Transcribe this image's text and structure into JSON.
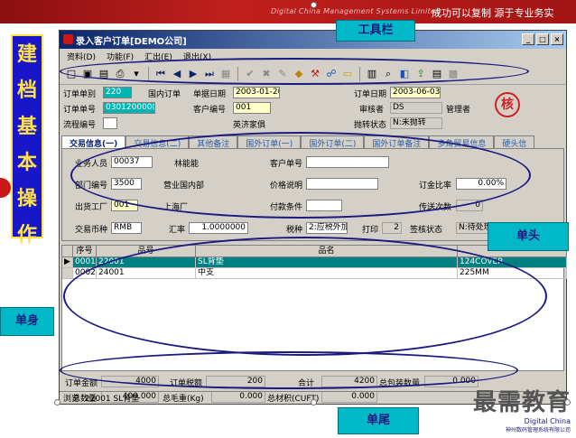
{
  "banner": {
    "english": "Digital China Management Systems Limited",
    "slogan": "成功可以复制   源于专业务实"
  },
  "side_title": {
    "chars": [
      "建",
      "档",
      "基",
      "本",
      "操",
      "作"
    ]
  },
  "window": {
    "title": "录入客户订单[DEMO公司]",
    "controls": [
      "_",
      "□",
      "×"
    ],
    "menu": [
      "资料(D)",
      "功能(F)",
      "汇出(E)",
      "退出(X)"
    ]
  },
  "toolbar_icons": [
    "new-icon",
    "save-icon",
    "delete-icon",
    "print-icon",
    "dropdown-icon",
    "first-icon",
    "prev-icon",
    "next-icon",
    "last-icon",
    "copy-icon",
    "check-icon",
    "cancel-icon",
    "edit-icon",
    "approve-icon",
    "tool-icon",
    "link-icon",
    "folder-icon",
    "attach-icon",
    "find-icon",
    "chart-icon",
    "export-icon",
    "report-icon",
    "calc-icon"
  ],
  "header": {
    "order_type_label": "订单单别",
    "order_type": "220",
    "order_type_name": "国内订单",
    "quote_date_label": "单据日期",
    "quote_date": "2003-01-20",
    "order_date_label": "订单日期",
    "order_date": "2003-06-03",
    "order_no_label": "订单单号",
    "order_no": "03012000001",
    "customer_no_label": "客户编号",
    "customer_no": "001",
    "customer_name": "英济家俱",
    "reviewer_label": "审核者",
    "reviewer": "DS",
    "reviewer_role": "管理者",
    "process_no_label": "流程编号",
    "transfer_status_label": "抛转状态",
    "transfer_status": "N:未抛转",
    "stamp": "核"
  },
  "tabs": [
    "交易信息(一)",
    "交易信息(二)",
    "其他备注",
    "国外订单(一)",
    "国外订单(二)",
    "国外订单备注",
    "多角贸易信息",
    "硬头信"
  ],
  "panel": {
    "salesperson_label": "业务人员",
    "salesperson": "00037",
    "salesperson_name": "林能能",
    "cust_order_label": "客户单号",
    "cust_order": "",
    "dept_label": "部门编号",
    "dept": "3500",
    "dept_name": "营业国内部",
    "price_label": "价格说明",
    "price": "",
    "deposit_label": "订金比率",
    "deposit": "0.00%",
    "factory_label": "出货工厂",
    "factory": "001",
    "factory_name": "上海厂",
    "pay_label": "付款条件",
    "pay": "",
    "trans_count_label": "传送次数",
    "trans_count": "0",
    "currency_label": "交易币种",
    "currency": "RMB",
    "rate_label": "汇率",
    "rate": "1.0000000",
    "tax_label": "税种",
    "tax": "2:应税外加",
    "print_label": "打印",
    "print": "2",
    "sign_label": "签核状态",
    "sign": "N:待处理"
  },
  "grid": {
    "headers": [
      "序号",
      "品号",
      "品名",
      ""
    ],
    "rows": [
      {
        "seq": "0001",
        "code": "22001",
        "name": "SL背垫",
        "spec": "124COVER"
      },
      {
        "seq": "0002",
        "code": "24001",
        "name": "中支",
        "spec": "225MM"
      }
    ]
  },
  "footer": {
    "amount_label": "订单金额",
    "amount": "4000",
    "tax_label": "订单税额",
    "tax": "200",
    "total_label": "合计",
    "total": "4200",
    "pack_label": "总包装数量",
    "pack": "0.000",
    "qty_label": "总数量",
    "qty": "400.000",
    "gross_label": "总毛重(Kg)",
    "gross": "0.000",
    "volume_label": "总材积(CUFT)",
    "volume": "0.000"
  },
  "status": {
    "label": "浏览",
    "value": "22001 SL背垫"
  },
  "callouts": {
    "toolbar": "工具栏",
    "header": "单头",
    "body": "单身",
    "footer": "单尾"
  },
  "brand": {
    "big": "最需教育",
    "small": "Digital China",
    "tiny": "神州数码管理系统有限公司"
  }
}
